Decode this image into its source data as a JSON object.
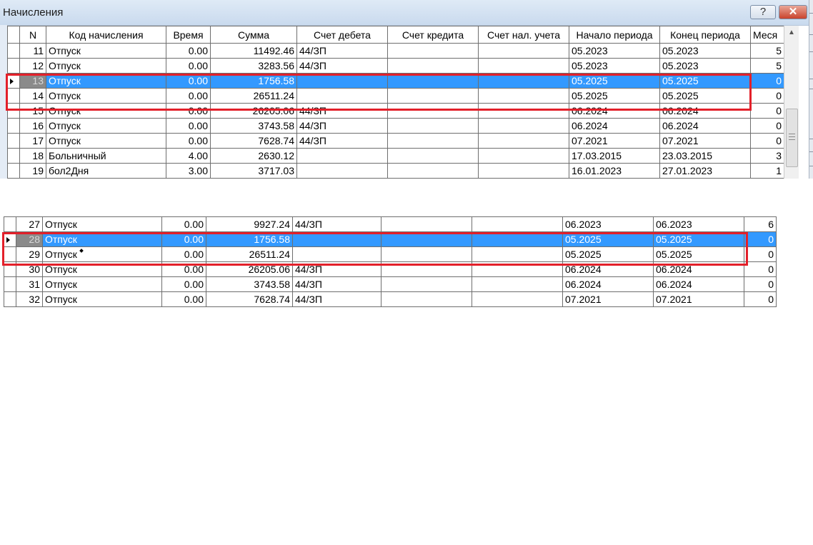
{
  "window": {
    "title": "Начисления",
    "help_label": "?",
    "close_label": "✕"
  },
  "columns": [
    "N",
    "Код начисления",
    "Время",
    "Сумма",
    "Счет дебета",
    "Счет кредита",
    "Счет нал. учета",
    "Начало периода",
    "Конец периода",
    "Меся"
  ],
  "top_rows": [
    {
      "n": "11",
      "code": "Отпуск",
      "time": "0.00",
      "sum": "11492.46",
      "debit": "44/ЗП",
      "credit": "",
      "tax": "",
      "start": "05.2023",
      "end": "05.2023",
      "month": "5",
      "selected": false
    },
    {
      "n": "12",
      "code": "Отпуск",
      "time": "0.00",
      "sum": "3283.56",
      "debit": "44/ЗП",
      "credit": "",
      "tax": "",
      "start": "05.2023",
      "end": "05.2023",
      "month": "5",
      "selected": false
    },
    {
      "n": "13",
      "code": "Отпуск",
      "time": "0.00",
      "sum": "1756.58",
      "debit": "",
      "credit": "",
      "tax": "",
      "start": "05.2025",
      "end": "05.2025",
      "month": "0",
      "selected": true
    },
    {
      "n": "14",
      "code": "Отпуск",
      "time": "0.00",
      "sum": "26511.24",
      "debit": "",
      "credit": "",
      "tax": "",
      "start": "05.2025",
      "end": "05.2025",
      "month": "0",
      "selected": false
    },
    {
      "n": "15",
      "code": "Отпуск",
      "time": "0.00",
      "sum": "26205.06",
      "debit": "44/ЗП",
      "credit": "",
      "tax": "",
      "start": "06.2024",
      "end": "06.2024",
      "month": "0",
      "selected": false
    },
    {
      "n": "16",
      "code": "Отпуск",
      "time": "0.00",
      "sum": "3743.58",
      "debit": "44/ЗП",
      "credit": "",
      "tax": "",
      "start": "06.2024",
      "end": "06.2024",
      "month": "0",
      "selected": false
    },
    {
      "n": "17",
      "code": "Отпуск",
      "time": "0.00",
      "sum": "7628.74",
      "debit": "44/ЗП",
      "credit": "",
      "tax": "",
      "start": "07.2021",
      "end": "07.2021",
      "month": "0",
      "selected": false
    },
    {
      "n": "18",
      "code": "Больничный",
      "time": "4.00",
      "sum": "2630.12",
      "debit": "",
      "credit": "",
      "tax": "",
      "start": "17.03.2015",
      "end": "23.03.2015",
      "month": "3",
      "selected": false
    },
    {
      "n": "19",
      "code": "бол2Дня",
      "time": "3.00",
      "sum": "3717.03",
      "debit": "",
      "credit": "",
      "tax": "",
      "start": "16.01.2023",
      "end": "27.01.2023",
      "month": "1",
      "selected": false
    }
  ],
  "bottom_rows": [
    {
      "n": "27",
      "code": "Отпуск",
      "time": "0.00",
      "sum": "9927.24",
      "debit": "44/ЗП",
      "credit": "",
      "tax": "",
      "start": "06.2023",
      "end": "06.2023",
      "month": "6",
      "selected": false
    },
    {
      "n": "28",
      "code": "Отпуск",
      "time": "0.00",
      "sum": "1756.58",
      "debit": "",
      "credit": "",
      "tax": "",
      "start": "05.2025",
      "end": "05.2025",
      "month": "0",
      "selected": true
    },
    {
      "n": "29",
      "code": "Отпуск",
      "time": "0.00",
      "sum": "26511.24",
      "debit": "",
      "credit": "",
      "tax": "",
      "start": "05.2025",
      "end": "05.2025",
      "month": "0",
      "selected": false
    },
    {
      "n": "30",
      "code": "Отпуск",
      "time": "0.00",
      "sum": "26205.06",
      "debit": "44/ЗП",
      "credit": "",
      "tax": "",
      "start": "06.2024",
      "end": "06.2024",
      "month": "0",
      "selected": false
    },
    {
      "n": "31",
      "code": "Отпуск",
      "time": "0.00",
      "sum": "3743.58",
      "debit": "44/ЗП",
      "credit": "",
      "tax": "",
      "start": "06.2024",
      "end": "06.2024",
      "month": "0",
      "selected": false
    },
    {
      "n": "32",
      "code": "Отпуск",
      "time": "0.00",
      "sum": "7628.74",
      "debit": "44/ЗП",
      "credit": "",
      "tax": "",
      "start": "07.2021",
      "end": "07.2021",
      "month": "0",
      "selected": false
    }
  ],
  "colors": {
    "selection": "#3399ff",
    "highlight": "#e3202a"
  }
}
